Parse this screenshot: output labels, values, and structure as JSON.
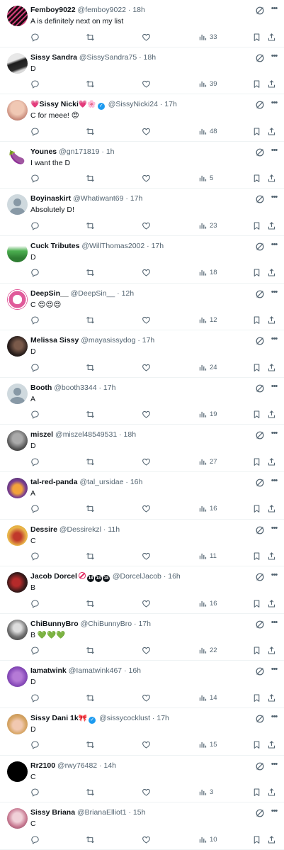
{
  "tweets": [
    {
      "avatar": "avatar-pink-stripes",
      "name": "Femboy9022",
      "name_emojis": "",
      "verified": false,
      "flags": "",
      "handle": "@femboy9022",
      "time": "18h",
      "text": "A is definitely next on my list",
      "views": "33"
    },
    {
      "avatar": "avatar-dark-shoes",
      "name": "Sissy Sandra",
      "name_emojis": "",
      "verified": false,
      "flags": "",
      "handle": "@SissySandra75",
      "time": "18h",
      "text": "D",
      "views": "39"
    },
    {
      "avatar": "avatar-photo-skin",
      "name": "Sissy Nicki",
      "name_pre": "💗",
      "name_emojis": "💗🌸",
      "verified": true,
      "flags": "",
      "handle": "@SissyNicki24",
      "time": "17h",
      "text": "C for meee! 😍",
      "views": "48"
    },
    {
      "avatar": "avatar-eggplant-emoji",
      "name": "Younes",
      "name_emojis": "",
      "verified": false,
      "flags": "",
      "handle": "@gn171819",
      "time": "1h",
      "text": "I want the D",
      "views": "5"
    },
    {
      "avatar": "avatar-default",
      "name": "Boyinaskirt",
      "name_emojis": "",
      "verified": false,
      "flags": "",
      "handle": "@Whatiwant69",
      "time": "17h",
      "text": "Absolutely D!",
      "views": "23"
    },
    {
      "avatar": "avatar-green-figure",
      "name": "Cuck Tributes",
      "name_emojis": "",
      "verified": false,
      "flags": "",
      "handle": "@WillThomas2002",
      "time": "17h",
      "text": "D",
      "views": "18"
    },
    {
      "avatar": "avatar-pink-logo",
      "name": "DeepSin__",
      "name_emojis": "",
      "verified": false,
      "flags": "",
      "handle": "@DeepSin__",
      "time": "12h",
      "text": "C 😍😍😍",
      "views": "12"
    },
    {
      "avatar": "avatar-dark-photo",
      "name": "Melissa Sissy",
      "name_emojis": "",
      "verified": false,
      "flags": "",
      "handle": "@mayasissydog",
      "time": "17h",
      "text": "D",
      "views": "24"
    },
    {
      "avatar": "avatar-default",
      "name": "Booth",
      "name_emojis": "",
      "verified": false,
      "flags": "",
      "handle": "@booth3344",
      "time": "17h",
      "text": "A",
      "views": "19"
    },
    {
      "avatar": "avatar-grey-photo",
      "name": "miszel",
      "name_emojis": "",
      "verified": false,
      "flags": "",
      "handle": "@miszel48549531",
      "time": "18h",
      "text": "D",
      "views": "27"
    },
    {
      "avatar": "avatar-red-panda",
      "name": "tal-red-panda",
      "name_emojis": "",
      "verified": false,
      "flags": "",
      "handle": "@tal_ursidae",
      "time": "16h",
      "text": "A",
      "views": "16"
    },
    {
      "avatar": "avatar-red-dress",
      "name": "Dessire",
      "name_emojis": "",
      "verified": false,
      "flags": "",
      "handle": "@Dessirekzl",
      "time": "11h",
      "text": "C",
      "views": "11"
    },
    {
      "avatar": "avatar-dark-red",
      "name": "Jacob Dorcel",
      "name_emojis": "",
      "verified": false,
      "flags": "no18",
      "handle": "@DorcelJacob",
      "time": "16h",
      "text": "B",
      "views": "16"
    },
    {
      "avatar": "avatar-bw-photo",
      "name": "ChiBunnyBro",
      "name_emojis": "",
      "verified": false,
      "flags": "",
      "handle": "@ChiBunnyBro",
      "time": "17h",
      "text": "B 💚💚💚",
      "views": "22"
    },
    {
      "avatar": "avatar-purple",
      "name": "Iamatwink",
      "name_emojis": "",
      "verified": false,
      "flags": "",
      "handle": "@Iamatwink467",
      "time": "16h",
      "text": "D",
      "views": "14"
    },
    {
      "avatar": "avatar-blonde",
      "name": "Sissy Dani 1k",
      "name_emojis": "🎀",
      "verified": true,
      "flags": "",
      "handle": "@sissycocklust",
      "time": "17h",
      "text": "D",
      "views": "15"
    },
    {
      "avatar": "avatar-black",
      "name": "Rr2100",
      "name_emojis": "",
      "verified": false,
      "flags": "",
      "handle": "@rwy76482",
      "time": "14h",
      "text": "C",
      "views": "3"
    },
    {
      "avatar": "avatar-pink-photo",
      "name": "Sissy Briana",
      "name_emojis": "",
      "verified": false,
      "flags": "",
      "handle": "@BrianaElliot1",
      "time": "15h",
      "text": "C",
      "views": "10"
    }
  ],
  "flag_badges": {
    "no18": "18"
  },
  "colors": {
    "icon": "#536471",
    "name": "#0f1419",
    "handle": "#536471",
    "divider": "#eff3f4",
    "verified": "#1d9bf0"
  },
  "icons": [
    "grok-icon",
    "more-icon",
    "reply-icon",
    "retweet-icon",
    "like-icon",
    "views-icon",
    "bookmark-icon",
    "share-icon"
  ]
}
